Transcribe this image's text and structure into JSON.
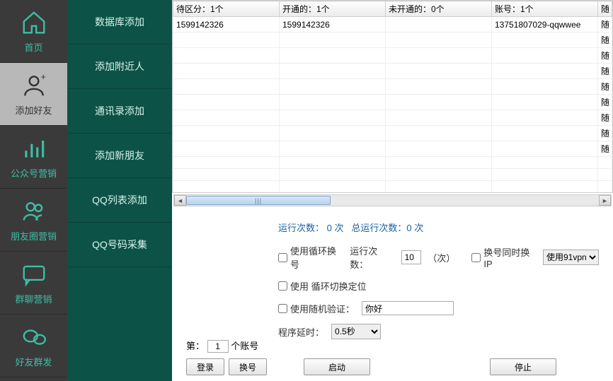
{
  "sidebar_main": [
    {
      "label": "首页",
      "icon": "home"
    },
    {
      "label": "添加好友",
      "icon": "add-friend"
    },
    {
      "label": "公众号营销",
      "icon": "bars"
    },
    {
      "label": "朋友圈营销",
      "icon": "people"
    },
    {
      "label": "群聊营销",
      "icon": "chat"
    },
    {
      "label": "好友群发",
      "icon": "bubbles"
    }
  ],
  "sidebar_sub": [
    {
      "label": "数据库添加"
    },
    {
      "label": "添加附近人"
    },
    {
      "label": "通讯录添加"
    },
    {
      "label": "添加新朋友"
    },
    {
      "label": "QQ列表添加"
    },
    {
      "label": "QQ号码采集"
    }
  ],
  "table": {
    "headers": {
      "col1": "待区分：1个",
      "col2": "开通的：1个",
      "col3": "未开通的：0个",
      "col4": "账号：1个",
      "col_extra": "随"
    },
    "row1": {
      "col1": "1599142326",
      "col2": "1599142326",
      "col3": "",
      "col4": "13751807029-qqwwee",
      "col_extra": "随"
    },
    "extra_rows_text": "随"
  },
  "stats": {
    "run_count_label": "运行次数：",
    "run_count_value": "0",
    "run_count_unit": "次",
    "total_run_label": "总运行次数：",
    "total_run_value": "0",
    "total_run_unit": "次"
  },
  "controls": {
    "loop_switch_label": "使用循环换号",
    "run_times_label": "运行次数：",
    "run_times_value": "10",
    "run_times_unit": "（次）",
    "switch_ip_label": "换号同时换IP",
    "vpn_option": "使用91vpn",
    "loop_locate_label": "使用 循环切换定位",
    "random_verify_label": "使用随机验证：",
    "random_verify_value": "你好",
    "delay_label": "程序延时：",
    "delay_value": "0.5秒"
  },
  "bottom": {
    "prefix": "第：",
    "account_index": "1",
    "suffix": "个账号",
    "login_btn": "登录",
    "switch_btn": "换号",
    "start_btn": "启动",
    "stop_btn": "停止"
  }
}
